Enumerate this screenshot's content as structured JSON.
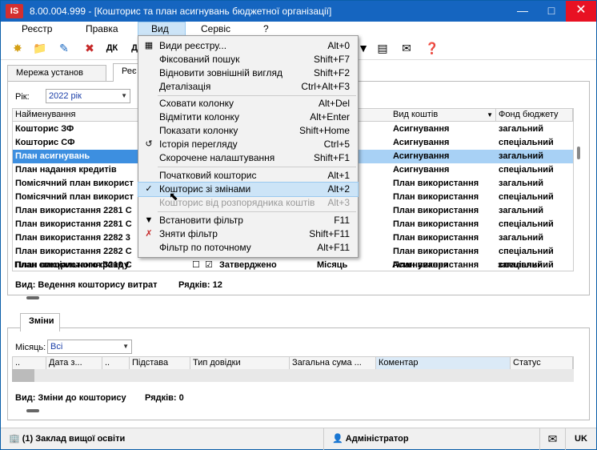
{
  "window": {
    "title": "8.00.004.999 - [Кошторис та план асигнувань бюджетної організації]",
    "logo": "IS"
  },
  "menubar": [
    "Реєстр",
    "Правка",
    "Вид",
    "Сервіс",
    "?"
  ],
  "tabs": [
    "Мережа установ",
    "Реє"
  ],
  "year": {
    "label": "Рік:",
    "value": "2022 рік"
  },
  "grid": {
    "columns": [
      "Найменування",
      "Вид коштів",
      "Фонд бюджету"
    ],
    "rows": [
      {
        "name": "Кошторис ЗФ",
        "kind": "Асигнування",
        "fund": "загальний"
      },
      {
        "name": "Кошторис СФ",
        "kind": "Асигнування",
        "fund": "спеціальний"
      },
      {
        "name": "План асигнувань",
        "kind": "Асигнування",
        "fund": "загальний"
      },
      {
        "name": "План надання кредитів",
        "kind": "Асигнування",
        "fund": "спеціальний"
      },
      {
        "name": "Помісячний план використ",
        "kind": "План використання",
        "fund": "загальний"
      },
      {
        "name": "Помісячний план використ",
        "kind": "План використання",
        "fund": "спеціальний"
      },
      {
        "name": "План використання 2281 С",
        "kind": "План використання",
        "fund": "загальний"
      },
      {
        "name": "План використання 2281 С",
        "kind": "План використання",
        "fund": "спеціальний"
      },
      {
        "name": "План використання 2282 3",
        "kind": "План використання",
        "fund": "загальний"
      },
      {
        "name": "План використання 2282 С",
        "kind": "План використання",
        "fund": "спеціальний"
      },
      {
        "name": "План використання 3210 С",
        "kind": "План використання",
        "fund": "спеціальний"
      },
      {
        "name": "План спеціального фонду",
        "status": "Затверджено",
        "period": "Місяць",
        "kind": "Асигнування",
        "fund": "загальний"
      }
    ],
    "footer_view": "Вид: Ведення кошторису витрат",
    "footer_rows": "Рядків: 12"
  },
  "changes": {
    "tab": "Зміни",
    "month_label": "Місяць:",
    "month_value": "Всі",
    "columns": [
      "..",
      "Дата з...",
      "..",
      "Підстава",
      "Тип довідки",
      "Загальна сума ...",
      "Коментар",
      "Статус"
    ],
    "footer_view": "Вид: Зміни до кошторису",
    "footer_rows": "Рядків: 0"
  },
  "statusbar": {
    "org": "(1) Заклад вищої освіти",
    "user": "Адміністратор",
    "lang": "UK"
  },
  "dropdown": [
    {
      "label": "Види реєстру...",
      "shortcut": "Alt+0",
      "icon": "table-icon"
    },
    {
      "label": "Фіксований пошук",
      "shortcut": "Shift+F7"
    },
    {
      "label": "Відновити зовнішній вигляд",
      "shortcut": "Shift+F2"
    },
    {
      "label": "Деталізація",
      "shortcut": "Ctrl+Alt+F3"
    },
    {
      "label": "Сховати колонку",
      "shortcut": "Alt+Del"
    },
    {
      "label": "Відмітити колонку",
      "shortcut": "Alt+Enter"
    },
    {
      "label": "Показати колонку",
      "shortcut": "Shift+Home"
    },
    {
      "label": "Історія перегляду",
      "shortcut": "Ctrl+5",
      "icon": "history-icon"
    },
    {
      "label": "Скорочене налаштування",
      "shortcut": "Shift+F1"
    },
    {
      "label": "Початковий кошторис",
      "shortcut": "Alt+1"
    },
    {
      "label": "Кошторис зі змінами",
      "shortcut": "Alt+2",
      "icon": "check-icon"
    },
    {
      "label": "Кошторис від розпорядника коштів",
      "shortcut": "Alt+3"
    },
    {
      "label": "Встановити фільтр",
      "shortcut": "F11",
      "icon": "filter-icon"
    },
    {
      "label": "Зняти фільтр",
      "shortcut": "Shift+F11",
      "icon": "filter-clear-icon"
    },
    {
      "label": "Фільтр по поточному",
      "shortcut": "Alt+F11"
    }
  ]
}
